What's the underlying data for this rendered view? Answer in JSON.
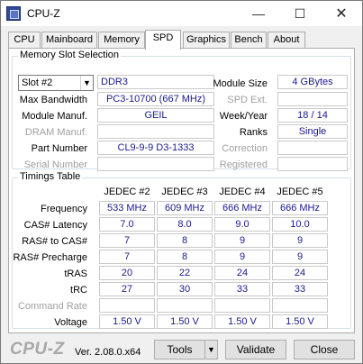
{
  "window": {
    "title": "CPU-Z",
    "minimize_glyph": "—",
    "maximize_glyph": "☐",
    "close_glyph": "✕"
  },
  "tabs": [
    {
      "label": "CPU"
    },
    {
      "label": "Mainboard"
    },
    {
      "label": "Memory"
    },
    {
      "label": "SPD",
      "active": true
    },
    {
      "label": "Graphics"
    },
    {
      "label": "Bench"
    },
    {
      "label": "About"
    }
  ],
  "slot_selection": {
    "group_title": "Memory Slot Selection",
    "selected_slot": "Slot #2",
    "memory_type": "DDR3",
    "labels": {
      "module_size": "Module Size",
      "max_bandwidth": "Max Bandwidth",
      "spd_ext": "SPD Ext.",
      "module_manuf": "Module Manuf.",
      "week_year": "Week/Year",
      "dram_manuf": "DRAM Manuf.",
      "ranks": "Ranks",
      "part_number": "Part Number",
      "correction": "Correction",
      "serial_number": "Serial Number",
      "registered": "Registered"
    },
    "values": {
      "module_size": "4 GBytes",
      "max_bandwidth": "PC3-10700 (667 MHz)",
      "spd_ext": "",
      "module_manuf": "GEIL",
      "week_year": "18 / 14",
      "dram_manuf": "",
      "ranks": "Single",
      "part_number": "CL9-9-9 D3-1333",
      "correction": "",
      "serial_number": "",
      "registered": ""
    }
  },
  "timings": {
    "group_title": "Timings Table",
    "columns": [
      "JEDEC #2",
      "JEDEC #3",
      "JEDEC #4",
      "JEDEC #5"
    ],
    "rows": [
      {
        "label": "Frequency",
        "dim": false,
        "values": [
          "533 MHz",
          "609 MHz",
          "666 MHz",
          "666 MHz"
        ]
      },
      {
        "label": "CAS# Latency",
        "dim": false,
        "values": [
          "7.0",
          "8.0",
          "9.0",
          "10.0"
        ]
      },
      {
        "label": "RAS# to CAS#",
        "dim": false,
        "values": [
          "7",
          "8",
          "9",
          "9"
        ]
      },
      {
        "label": "RAS# Precharge",
        "dim": false,
        "values": [
          "7",
          "8",
          "9",
          "9"
        ]
      },
      {
        "label": "tRAS",
        "dim": false,
        "values": [
          "20",
          "22",
          "24",
          "24"
        ]
      },
      {
        "label": "tRC",
        "dim": false,
        "values": [
          "27",
          "30",
          "33",
          "33"
        ]
      },
      {
        "label": "Command Rate",
        "dim": true,
        "values": [
          "",
          "",
          "",
          ""
        ]
      },
      {
        "label": "Voltage",
        "dim": false,
        "values": [
          "1.50 V",
          "1.50 V",
          "1.50 V",
          "1.50 V"
        ]
      }
    ]
  },
  "footer": {
    "logo": "CPU-Z",
    "version": "Ver. 2.08.0.x64",
    "tools_label": "Tools",
    "validate_label": "Validate",
    "close_label": "Close"
  },
  "colors": {
    "value_text": "#1a1a8c",
    "window_bg": "#f0f0f0",
    "panel_bg": "#ffffff"
  }
}
